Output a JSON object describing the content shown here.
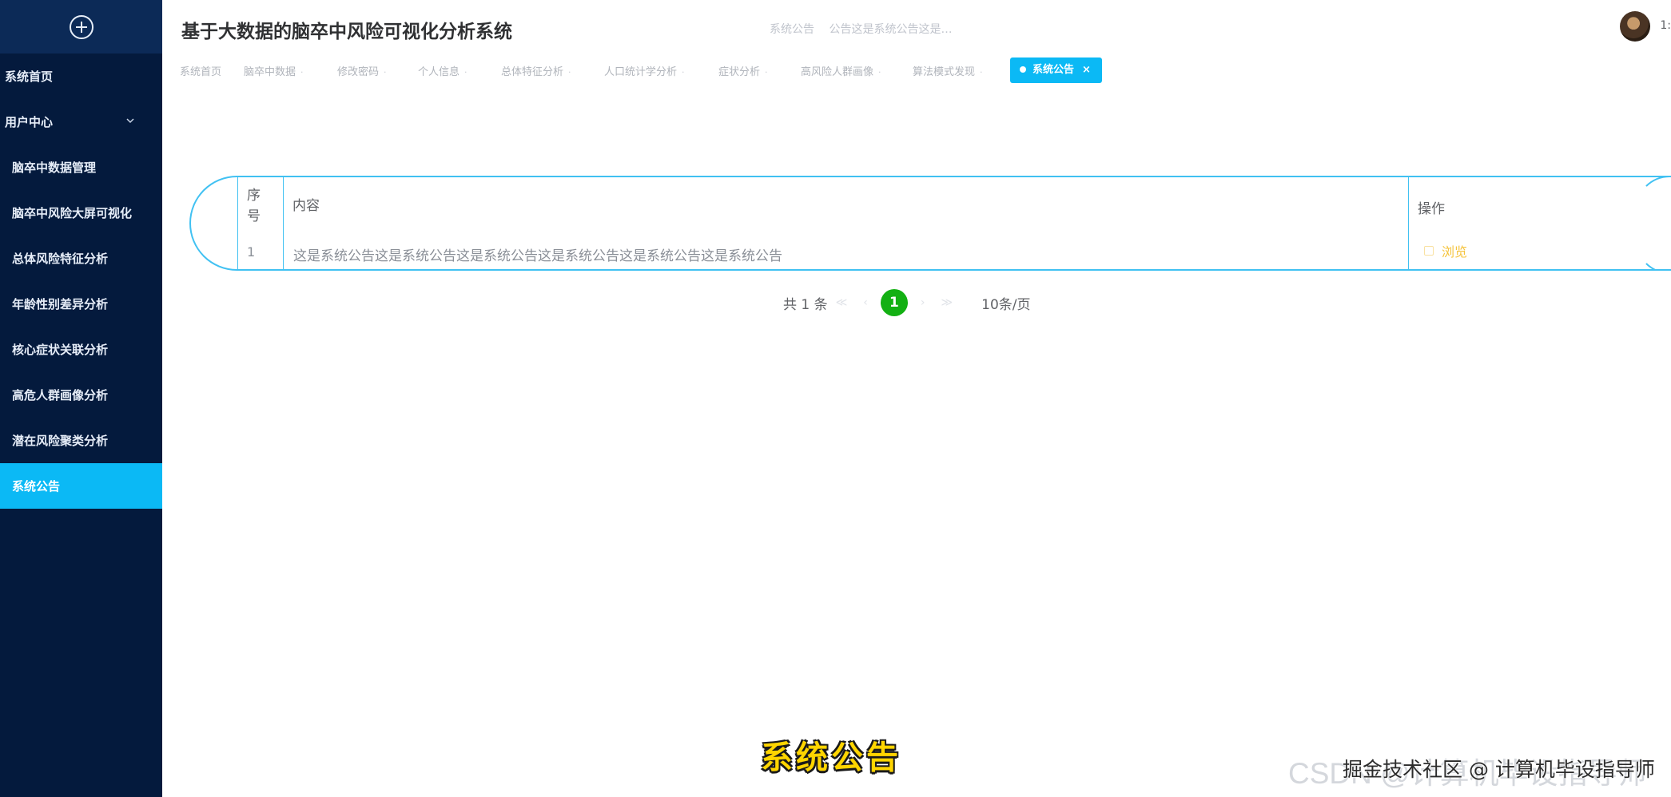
{
  "sidebar": {
    "items": [
      {
        "label": "系统首页",
        "sub": false,
        "active": false
      },
      {
        "label": "用户中心",
        "sub": false,
        "active": false,
        "expandable": true
      },
      {
        "label": "脑卒中数据管理",
        "sub": true,
        "active": false
      },
      {
        "label": "脑卒中风险大屏可视化",
        "sub": true,
        "active": false
      },
      {
        "label": "总体风险特征分析",
        "sub": true,
        "active": false
      },
      {
        "label": "年龄性别差异分析",
        "sub": true,
        "active": false
      },
      {
        "label": "核心症状关联分析",
        "sub": true,
        "active": false
      },
      {
        "label": "高危人群画像分析",
        "sub": true,
        "active": false
      },
      {
        "label": "潜在风险聚类分析",
        "sub": true,
        "active": false
      },
      {
        "label": "系统公告",
        "sub": true,
        "active": true
      }
    ]
  },
  "header": {
    "title": "基于大数据的脑卒中风险可视化分析系统",
    "notice_label": "系统公告",
    "notice_text": "公告这是系统公告这是…",
    "user_extra": "1:"
  },
  "tabs": [
    {
      "label": "系统首页"
    },
    {
      "label": "脑卒中数据"
    },
    {
      "label": "修改密码"
    },
    {
      "label": "个人信息"
    },
    {
      "label": "总体特征分析"
    },
    {
      "label": "人口统计学分析"
    },
    {
      "label": "症状分析"
    },
    {
      "label": "高风险人群画像"
    },
    {
      "label": "算法模式发现"
    },
    {
      "label": "系统公告",
      "active": true
    }
  ],
  "table": {
    "headers": {
      "index": "序\n号",
      "content": "内容",
      "action": "操作"
    },
    "rows": [
      {
        "index": "1",
        "content": "这是系统公告这是系统公告这是系统公告这是系统公告这是系统公告这是系统公告",
        "action": "浏览"
      }
    ]
  },
  "pagination": {
    "total": "共 1 条",
    "current": "1",
    "page_size": "10条/页"
  },
  "caption": "系统公告",
  "watermarks": {
    "csdn": "CSDN @计算机毕设指导师",
    "juejin": "掘金技术社区 @ 计算机毕设指导师"
  },
  "colors": {
    "sidebar_bg": "#041a3d",
    "active_accent": "#0bb9f5",
    "page_current": "#13b013",
    "action_color": "#f5c33b"
  }
}
